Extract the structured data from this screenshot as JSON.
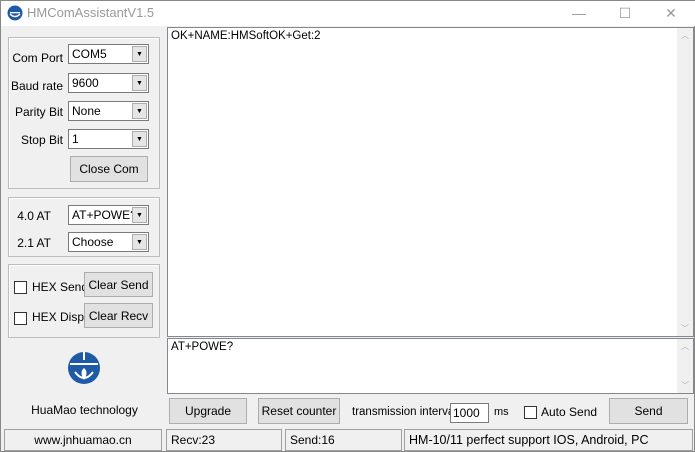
{
  "window": {
    "title": "HMComAssistantV1.5",
    "minimize": "—",
    "maximize": "☐",
    "close": "✕"
  },
  "settings": {
    "com_port": {
      "label": "Com Port",
      "value": "COM5"
    },
    "baud_rate": {
      "label": "Baud rate",
      "value": "9600"
    },
    "parity_bit": {
      "label": "Parity Bit",
      "value": "None"
    },
    "stop_bit": {
      "label": "Stop Bit",
      "value": "1"
    },
    "close_com": "Close Com"
  },
  "at": {
    "at40": {
      "label": "4.0 AT",
      "value": "AT+POWE?"
    },
    "at21": {
      "label": "2.1 AT",
      "value": "Choose"
    }
  },
  "hex": {
    "hex_send": "HEX Send",
    "clear_send": "Clear Send",
    "hex_disp": "HEX Disp",
    "clear_recv": "Clear Recv"
  },
  "brand": "HuaMao technology",
  "receive_text": "OK+NAME:HMSoftOK+Get:2",
  "send_text": "AT+POWE?",
  "toolbar": {
    "upgrade": "Upgrade",
    "reset_counter": "Reset counter",
    "interval_label": "transmission interval",
    "interval_value": "1000",
    "ms": "ms",
    "auto_send": "Auto Send",
    "send": "Send"
  },
  "status": {
    "website": "www.jnhuamao.cn",
    "recv": "Recv:23",
    "send": "Send:16",
    "info": "HM-10/11 perfect support IOS, Android, PC"
  }
}
